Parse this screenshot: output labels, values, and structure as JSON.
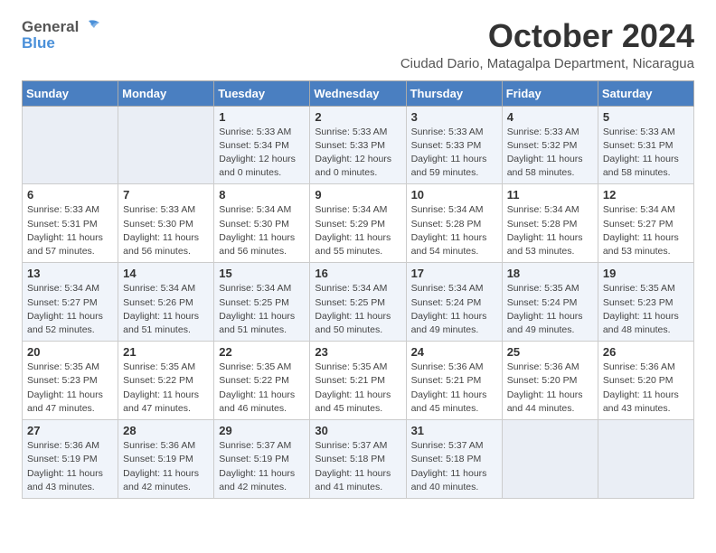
{
  "logo": {
    "general": "General",
    "blue": "Blue"
  },
  "title": "October 2024",
  "subtitle": "Ciudad Dario, Matagalpa Department, Nicaragua",
  "days_header": [
    "Sunday",
    "Monday",
    "Tuesday",
    "Wednesday",
    "Thursday",
    "Friday",
    "Saturday"
  ],
  "weeks": [
    [
      {
        "num": "",
        "info": ""
      },
      {
        "num": "",
        "info": ""
      },
      {
        "num": "1",
        "info": "Sunrise: 5:33 AM\nSunset: 5:34 PM\nDaylight: 12 hours\nand 0 minutes."
      },
      {
        "num": "2",
        "info": "Sunrise: 5:33 AM\nSunset: 5:33 PM\nDaylight: 12 hours\nand 0 minutes."
      },
      {
        "num": "3",
        "info": "Sunrise: 5:33 AM\nSunset: 5:33 PM\nDaylight: 11 hours\nand 59 minutes."
      },
      {
        "num": "4",
        "info": "Sunrise: 5:33 AM\nSunset: 5:32 PM\nDaylight: 11 hours\nand 58 minutes."
      },
      {
        "num": "5",
        "info": "Sunrise: 5:33 AM\nSunset: 5:31 PM\nDaylight: 11 hours\nand 58 minutes."
      }
    ],
    [
      {
        "num": "6",
        "info": "Sunrise: 5:33 AM\nSunset: 5:31 PM\nDaylight: 11 hours\nand 57 minutes."
      },
      {
        "num": "7",
        "info": "Sunrise: 5:33 AM\nSunset: 5:30 PM\nDaylight: 11 hours\nand 56 minutes."
      },
      {
        "num": "8",
        "info": "Sunrise: 5:34 AM\nSunset: 5:30 PM\nDaylight: 11 hours\nand 56 minutes."
      },
      {
        "num": "9",
        "info": "Sunrise: 5:34 AM\nSunset: 5:29 PM\nDaylight: 11 hours\nand 55 minutes."
      },
      {
        "num": "10",
        "info": "Sunrise: 5:34 AM\nSunset: 5:28 PM\nDaylight: 11 hours\nand 54 minutes."
      },
      {
        "num": "11",
        "info": "Sunrise: 5:34 AM\nSunset: 5:28 PM\nDaylight: 11 hours\nand 53 minutes."
      },
      {
        "num": "12",
        "info": "Sunrise: 5:34 AM\nSunset: 5:27 PM\nDaylight: 11 hours\nand 53 minutes."
      }
    ],
    [
      {
        "num": "13",
        "info": "Sunrise: 5:34 AM\nSunset: 5:27 PM\nDaylight: 11 hours\nand 52 minutes."
      },
      {
        "num": "14",
        "info": "Sunrise: 5:34 AM\nSunset: 5:26 PM\nDaylight: 11 hours\nand 51 minutes."
      },
      {
        "num": "15",
        "info": "Sunrise: 5:34 AM\nSunset: 5:25 PM\nDaylight: 11 hours\nand 51 minutes."
      },
      {
        "num": "16",
        "info": "Sunrise: 5:34 AM\nSunset: 5:25 PM\nDaylight: 11 hours\nand 50 minutes."
      },
      {
        "num": "17",
        "info": "Sunrise: 5:34 AM\nSunset: 5:24 PM\nDaylight: 11 hours\nand 49 minutes."
      },
      {
        "num": "18",
        "info": "Sunrise: 5:35 AM\nSunset: 5:24 PM\nDaylight: 11 hours\nand 49 minutes."
      },
      {
        "num": "19",
        "info": "Sunrise: 5:35 AM\nSunset: 5:23 PM\nDaylight: 11 hours\nand 48 minutes."
      }
    ],
    [
      {
        "num": "20",
        "info": "Sunrise: 5:35 AM\nSunset: 5:23 PM\nDaylight: 11 hours\nand 47 minutes."
      },
      {
        "num": "21",
        "info": "Sunrise: 5:35 AM\nSunset: 5:22 PM\nDaylight: 11 hours\nand 47 minutes."
      },
      {
        "num": "22",
        "info": "Sunrise: 5:35 AM\nSunset: 5:22 PM\nDaylight: 11 hours\nand 46 minutes."
      },
      {
        "num": "23",
        "info": "Sunrise: 5:35 AM\nSunset: 5:21 PM\nDaylight: 11 hours\nand 45 minutes."
      },
      {
        "num": "24",
        "info": "Sunrise: 5:36 AM\nSunset: 5:21 PM\nDaylight: 11 hours\nand 45 minutes."
      },
      {
        "num": "25",
        "info": "Sunrise: 5:36 AM\nSunset: 5:20 PM\nDaylight: 11 hours\nand 44 minutes."
      },
      {
        "num": "26",
        "info": "Sunrise: 5:36 AM\nSunset: 5:20 PM\nDaylight: 11 hours\nand 43 minutes."
      }
    ],
    [
      {
        "num": "27",
        "info": "Sunrise: 5:36 AM\nSunset: 5:19 PM\nDaylight: 11 hours\nand 43 minutes."
      },
      {
        "num": "28",
        "info": "Sunrise: 5:36 AM\nSunset: 5:19 PM\nDaylight: 11 hours\nand 42 minutes."
      },
      {
        "num": "29",
        "info": "Sunrise: 5:37 AM\nSunset: 5:19 PM\nDaylight: 11 hours\nand 42 minutes."
      },
      {
        "num": "30",
        "info": "Sunrise: 5:37 AM\nSunset: 5:18 PM\nDaylight: 11 hours\nand 41 minutes."
      },
      {
        "num": "31",
        "info": "Sunrise: 5:37 AM\nSunset: 5:18 PM\nDaylight: 11 hours\nand 40 minutes."
      },
      {
        "num": "",
        "info": ""
      },
      {
        "num": "",
        "info": ""
      }
    ]
  ]
}
